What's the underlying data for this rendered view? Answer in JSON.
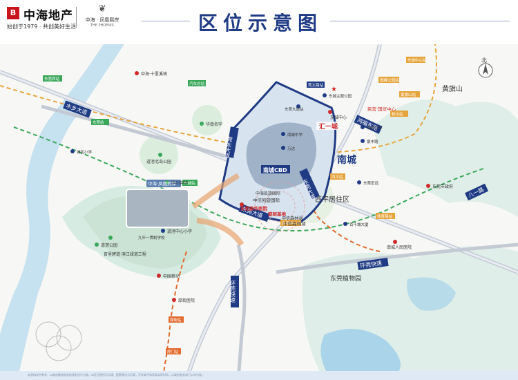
{
  "header": {
    "brand_mark": "B",
    "brand_name": "中海地产",
    "slogan": "始创于1979 · 共创美好生活",
    "project_name": "中海 · 凤凰熙岸",
    "project_en": "THE PHOENIX",
    "title": "区位示意图"
  },
  "map": {
    "north": "北",
    "mountains": [
      "黄旗山"
    ],
    "districts": [
      {
        "name": "南城"
      },
      {
        "name": "汇一城"
      },
      {
        "name": "南城CBD"
      },
      {
        "name": "西平居住区"
      },
      {
        "name": "东莞植物园"
      }
    ],
    "roads": [
      {
        "name": "水乡大道"
      },
      {
        "name": "莞太大道"
      },
      {
        "name": "鸿福东路"
      },
      {
        "name": "东莞大道"
      },
      {
        "name": "八一路"
      },
      {
        "name": "环莞快速"
      },
      {
        "name": "环莞快速"
      }
    ],
    "metro_stations": [
      "东莞西站",
      "东莞站",
      "蛟山站",
      "东城中心站",
      "民营·国贸中心",
      "旗峰公园站",
      "西平站",
      "体育路站",
      "东城站",
      "会展中心站",
      "黄旗山站",
      "厚街站",
      "虎门站"
    ],
    "poi_red": [
      "中海·十里溪境",
      "东莞康华医院",
      "厚街医院",
      "中国移动",
      "中海凯旋国际",
      "东城中心",
      "东莞市政府",
      "南城人民医院"
    ],
    "poi_blue": [
      "莞太路站",
      "东莞大道站",
      "东城主题公园",
      "南城中学",
      "银丰路",
      "东莞宏远",
      "万达",
      "百千城大厦"
    ],
    "poi_green": [
      "道滘北岛公园",
      "道滘公园",
      "百里碧道·滨江绿道工程",
      "济川中学",
      "汽车总站",
      "中信森林湖",
      "华南名宇"
    ],
    "schools": [
      "道滘中心小学",
      "九年一贯制学校",
      "城区小学",
      "南城中学"
    ],
    "project_label": "中海·凤凰熙岸",
    "annotations": [
      "都邮基地",
      "中信凯旋国际",
      "中信森林湖"
    ],
    "legend_star": "★"
  },
  "footer": {
    "disclaimer": "本资料仅供参考，以政府最终批准的规划设计为准。本区位图所示交通、配套等仅为示意，开发商不承诺其实现时间，以政府相关部门公布为准。"
  }
}
